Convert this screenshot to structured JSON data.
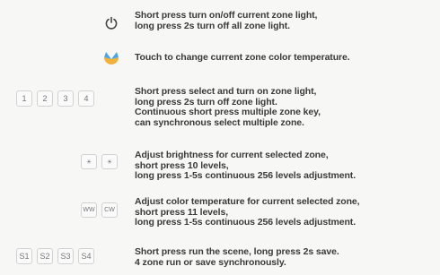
{
  "rows": {
    "power": {
      "icon": "power-icon",
      "text": "Short press turn on/off current zone light,\nlong press 2s turn off all zone light."
    },
    "color_temp_touch": {
      "icon": "color-wheel-icon",
      "text": "Touch to change current zone color temperature."
    },
    "zones": {
      "keys": [
        "1",
        "2",
        "3",
        "4"
      ],
      "text": "Short press select and turn on zone light,\nlong press 2s turn off zone light.\nContinuous short press multiple zone key,\ncan synchronous select multiple zone."
    },
    "brightness": {
      "keys": [
        "☀",
        "☀"
      ],
      "text": "Adjust brightness for current selected zone,\nshort press 10 levels,\nlong press 1-5s continuous 256 levels adjustment."
    },
    "cct": {
      "keys": [
        "WW",
        "CW"
      ],
      "text": "Adjust color temperature for current selected zone,\nshort press 11 levels,\nlong press 1-5s continuous 256 levels adjustment."
    },
    "scenes": {
      "keys": [
        "S1",
        "S2",
        "S3",
        "S4"
      ],
      "text": "Short press run the scene, long press 2s save.\n4 zone run or save synchronously."
    }
  },
  "colors": {
    "background": "#f7f7f5",
    "text": "#3a3a3a",
    "key_border": "#d2d2d2",
    "color_wheel_warm": "#f3b237",
    "color_wheel_cool": "#4aa6e8"
  }
}
